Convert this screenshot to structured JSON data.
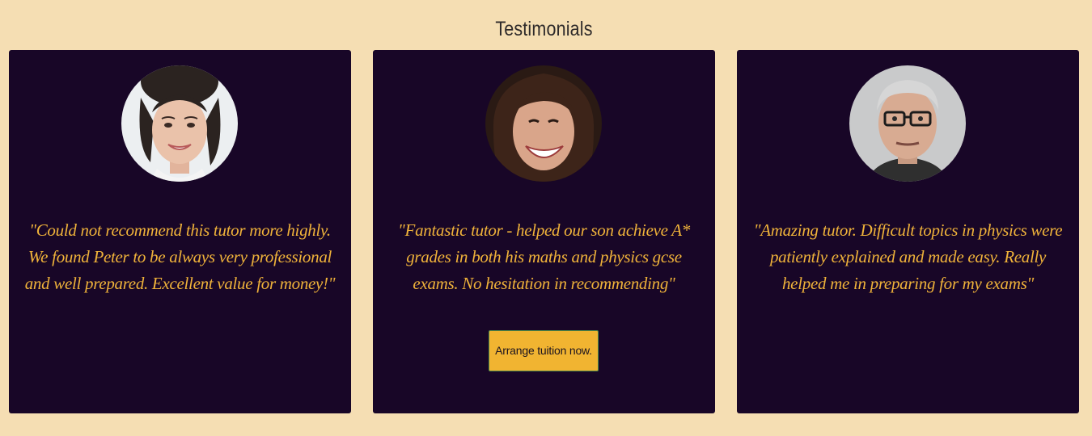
{
  "section": {
    "title": "Testimonials"
  },
  "testimonials": [
    {
      "quote": "\"Could not recommend this tutor more highly. We found Peter to be always very professional and well prepared. Excellent value for money!\""
    },
    {
      "quote": "\"Fantastic tutor - helped our son achieve A* grades in both his maths and physics gcse exams. No hesitation in recommending\"",
      "cta_label": "Arrange tuition now."
    },
    {
      "quote": "\"Amazing tutor. Difficult topics in physics were patiently explained and made easy. Really helped me in preparing for my exams\""
    }
  ],
  "colors": {
    "page_background": "#f5deb3",
    "card_background": "#180627",
    "quote_text": "#f0b33a",
    "button_background": "#f1b431",
    "button_border": "#4e8a4a"
  }
}
